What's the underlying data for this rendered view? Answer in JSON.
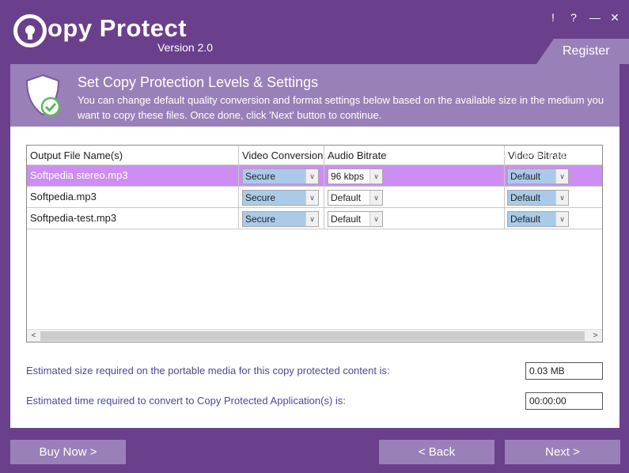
{
  "app": {
    "title": "Copy Protect",
    "title_rest": "opy Protect",
    "version": "Version 2.0",
    "controls": [
      "!",
      "?",
      "—",
      "✕"
    ],
    "register_label": "Register"
  },
  "header": {
    "title": "Set Copy Protection Levels & Settings",
    "description": "You can change default quality conversion and format settings below based on the available size in the medium you want to copy these files. Once done, click 'Next' button to continue."
  },
  "grid": {
    "columns": [
      "Output File Name(s)",
      "Video Conversion",
      "Audio Bitrate",
      "Video Bitrate"
    ],
    "rows": [
      {
        "name": "Softpedia stereo.mp3",
        "video_conversion": "Secure",
        "audio_bitrate": "96 kbps",
        "video_bitrate": "Default",
        "selected": true
      },
      {
        "name": "Softpedia.mp3",
        "video_conversion": "Secure",
        "audio_bitrate": "Default",
        "video_bitrate": "Default",
        "selected": false
      },
      {
        "name": "Softpedia-test.mp3",
        "video_conversion": "Secure",
        "audio_bitrate": "Default",
        "video_bitrate": "Default",
        "selected": false
      }
    ],
    "scroll_left": "<",
    "scroll_right": ">"
  },
  "estimates": {
    "size_label": "Estimated size required on the portable media for this copy protected content is:",
    "size_value": "0.03 MB",
    "time_label": "Estimated time required to convert to Copy Protected Application(s) is:",
    "time_value": "00:00:00"
  },
  "footer": {
    "buy_now": "Buy Now >",
    "back": "< Back",
    "next": "Next >"
  },
  "watermark": "SOFTPEDIA",
  "colors": {
    "background": "#6a3f8c",
    "accent": "#9a80b8",
    "selected_row": "#cc8ef2",
    "select_blue": "#a9cbe8",
    "check_green": "#5cb85c"
  }
}
